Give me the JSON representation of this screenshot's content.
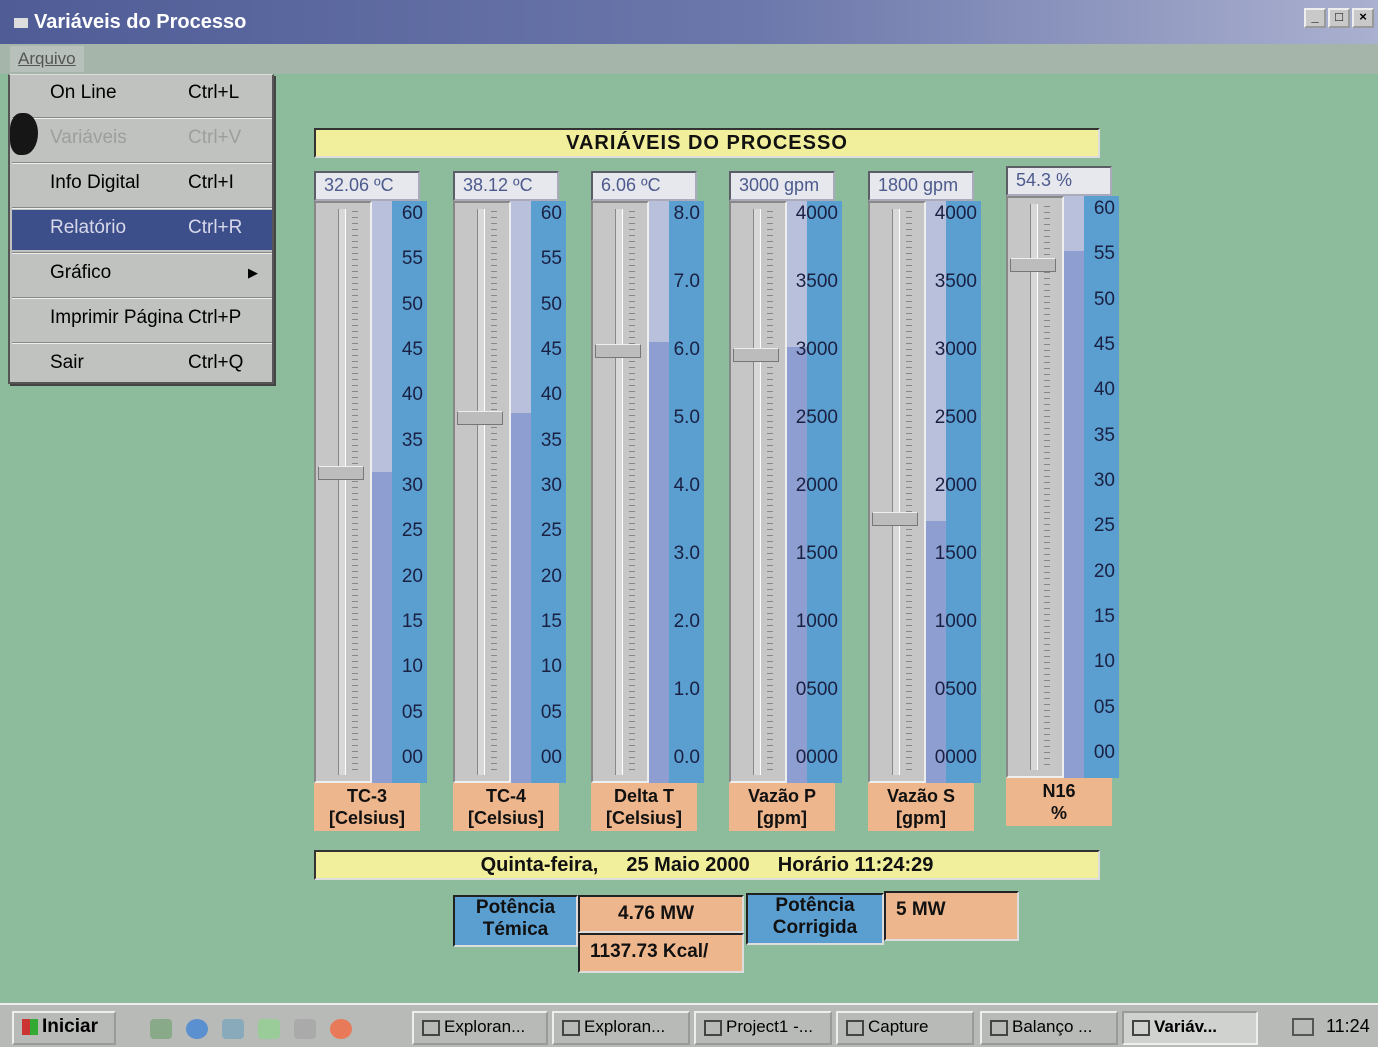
{
  "window": {
    "title": "Variáveis do Processo",
    "controls": [
      "_",
      "□",
      "×"
    ]
  },
  "menubar": {
    "menu": "Arquivo"
  },
  "menu_items": [
    {
      "label": "On Line",
      "shortcut": "Ctrl+L",
      "state": "normal"
    },
    {
      "label": "Variáveis",
      "shortcut": "Ctrl+V",
      "state": "disabled"
    },
    {
      "label": "Info Digital",
      "shortcut": "Ctrl+I",
      "state": "normal"
    },
    {
      "label": "Relatório",
      "shortcut": "Ctrl+R",
      "state": "selected"
    },
    {
      "label": "Gráfico",
      "shortcut": "",
      "state": "submenu"
    },
    {
      "label": "Imprimir Página",
      "shortcut": "Ctrl+P",
      "state": "normal"
    },
    {
      "label": "Sair",
      "shortcut": "Ctrl+Q",
      "state": "normal"
    }
  ],
  "header": {
    "title": "VARIÁVEIS DO PROCESSO"
  },
  "gauges": [
    {
      "id": "tc3",
      "readout": "32.06 ºC",
      "label1": "TC-3",
      "label2": "[Celsius]",
      "ticks": [
        "60",
        "55",
        "50",
        "45",
        "40",
        "35",
        "30",
        "25",
        "20",
        "15",
        "10",
        "05",
        "00"
      ],
      "fill_fraction": 0.534
    },
    {
      "id": "tc4",
      "readout": "38.12 ºC",
      "label1": "TC-4",
      "label2": "[Celsius]",
      "ticks": [
        "60",
        "55",
        "50",
        "45",
        "40",
        "35",
        "30",
        "25",
        "20",
        "15",
        "10",
        "05",
        "00"
      ],
      "fill_fraction": 0.635
    },
    {
      "id": "deltat",
      "readout": "6.06 ºC",
      "label1": "Delta T",
      "label2": "[Celsius]",
      "ticks": [
        "8.0",
        "7.0",
        "6.0",
        "5.0",
        "4.0",
        "3.0",
        "2.0",
        "1.0",
        "0.0"
      ],
      "fill_fraction": 0.757
    },
    {
      "id": "vazaop",
      "readout": "3000 gpm",
      "label1": "Vazão P",
      "label2": "[gpm]",
      "ticks": [
        "4000",
        "3500",
        "3000",
        "2500",
        "2000",
        "1500",
        "1000",
        "0500",
        "0000"
      ],
      "fill_fraction": 0.75
    },
    {
      "id": "vazaos",
      "readout": "1800 gpm",
      "label1": "Vazão S",
      "label2": "[gpm]",
      "ticks": [
        "4000",
        "3500",
        "3000",
        "2500",
        "2000",
        "1500",
        "1000",
        "0500",
        "0000"
      ],
      "fill_fraction": 0.45
    },
    {
      "id": "n16",
      "readout": "54.3 %",
      "label1": "N16",
      "label2": "%",
      "ticks": [
        "60",
        "55",
        "50",
        "45",
        "40",
        "35",
        "30",
        "25",
        "20",
        "15",
        "10",
        "05",
        "00"
      ],
      "fill_fraction": 0.905
    }
  ],
  "status": {
    "weekday": "Quinta-feira,",
    "date": "25 Maio 2000",
    "time_label": "Horário 11:24:29"
  },
  "power": {
    "thermal_label_1": "Potência",
    "thermal_label_2": "Témica",
    "thermal_mw": "4.76 MW",
    "thermal_kcal": "1137.73 Kcal/",
    "corrected_label_1": "Potência",
    "corrected_label_2": "Corrigida",
    "corrected_mw": "5 MW"
  },
  "taskbar": {
    "start": "Iniciar",
    "tasks": [
      {
        "label": "Exploran..."
      },
      {
        "label": "Exploran..."
      },
      {
        "label": "Project1 -..."
      },
      {
        "label": "Capture"
      },
      {
        "label": "Balanço ..."
      },
      {
        "label": "Variáv...",
        "active": true
      }
    ],
    "clock": "11:24"
  },
  "colors": {
    "background": "#8dbc9c",
    "scale_blue": "#5b9ed0",
    "label_orange": "#eeb68c",
    "banner_yellow": "#f2ef9c",
    "selection": "#3c4f8b"
  }
}
